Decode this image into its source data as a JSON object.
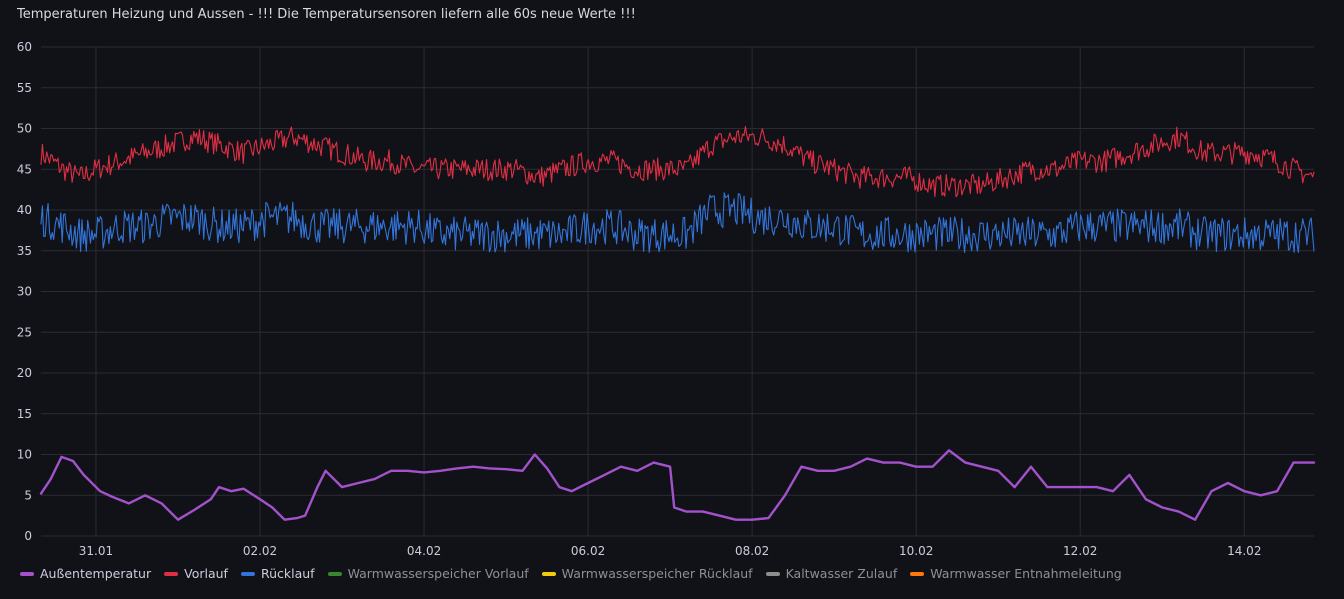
{
  "panel": {
    "title": "Temperaturen Heizung und Aussen - !!! Die Temperatursensoren liefern alle 60s neue Werte !!!"
  },
  "chart_data": {
    "type": "line",
    "title": "Temperaturen Heizung und Aussen - !!! Die Temperatursensoren liefern alle 60s neue Werte !!!",
    "xlabel": "",
    "ylabel": "",
    "ylim": [
      0,
      60
    ],
    "y_ticks": [
      0,
      5,
      10,
      15,
      20,
      25,
      30,
      35,
      40,
      45,
      50,
      55,
      60
    ],
    "x_ticks": [
      "31.01",
      "02.02",
      "04.02",
      "06.02",
      "08.02",
      "10.02",
      "12.02",
      "14.02"
    ],
    "x_range_days": [
      -0.67,
      14.85
    ],
    "grid": true,
    "legend_position": "bottom-left",
    "series": [
      {
        "name": "Außentemperatur",
        "color": "#a352cc",
        "visible": true,
        "x": [
          -0.67,
          -0.55,
          -0.42,
          -0.28,
          -0.15,
          0.05,
          0.2,
          0.4,
          0.6,
          0.8,
          1.0,
          1.2,
          1.4,
          1.5,
          1.65,
          1.8,
          2.0,
          2.15,
          2.3,
          2.45,
          2.55,
          2.7,
          2.8,
          3.0,
          3.2,
          3.4,
          3.6,
          3.8,
          4.0,
          4.2,
          4.4,
          4.6,
          4.8,
          5.0,
          5.2,
          5.35,
          5.5,
          5.65,
          5.8,
          6.0,
          6.2,
          6.4,
          6.6,
          6.8,
          7.0,
          7.05,
          7.2,
          7.4,
          7.6,
          7.8,
          8.0,
          8.2,
          8.4,
          8.6,
          8.8,
          9.0,
          9.2,
          9.4,
          9.6,
          9.8,
          10.0,
          10.2,
          10.4,
          10.6,
          10.8,
          11.0,
          11.2,
          11.4,
          11.6,
          11.8,
          12.0,
          12.2,
          12.4,
          12.6,
          12.8,
          13.0,
          13.2,
          13.4,
          13.6,
          13.8,
          14.0,
          14.2,
          14.4,
          14.6,
          14.85
        ],
        "y": [
          5.2,
          7.0,
          9.7,
          9.2,
          7.5,
          5.5,
          4.8,
          4.0,
          5.0,
          4.0,
          2.0,
          3.2,
          4.5,
          6.0,
          5.5,
          5.8,
          4.5,
          3.5,
          2.0,
          2.2,
          2.5,
          6.0,
          8.0,
          6.0,
          6.5,
          7.0,
          8.0,
          8.0,
          7.8,
          8.0,
          8.3,
          8.5,
          8.3,
          8.2,
          8.0,
          10.0,
          8.3,
          6.0,
          5.5,
          6.5,
          7.5,
          8.5,
          8.0,
          9.0,
          8.5,
          3.5,
          3.0,
          3.0,
          2.5,
          2.0,
          2.0,
          2.2,
          5.0,
          8.5,
          8.0,
          8.0,
          8.5,
          9.5,
          9.0,
          9.0,
          8.5,
          8.5,
          10.5,
          9.0,
          8.5,
          8.0,
          6.0,
          8.5,
          6.0,
          6.0,
          6.0,
          6.0,
          5.5,
          7.5,
          4.5,
          3.5,
          3.0,
          2.0,
          5.5,
          6.5,
          5.5,
          5.0,
          5.5,
          9.0,
          9.0
        ]
      },
      {
        "name": "Vorlauf",
        "color": "#e02f44",
        "visible": true,
        "x": [
          -0.67,
          -0.4,
          -0.2,
          0.0,
          0.3,
          0.6,
          0.9,
          1.2,
          1.5,
          1.8,
          2.1,
          2.4,
          2.7,
          3.0,
          3.3,
          3.6,
          3.9,
          4.2,
          4.5,
          4.8,
          5.1,
          5.4,
          5.7,
          6.0,
          6.3,
          6.6,
          6.9,
          7.2,
          7.5,
          7.8,
          8.1,
          8.4,
          8.7,
          9.0,
          9.3,
          9.6,
          9.9,
          10.2,
          10.5,
          10.8,
          11.1,
          11.4,
          11.7,
          12.0,
          12.3,
          12.6,
          12.9,
          13.2,
          13.5,
          13.8,
          14.1,
          14.4,
          14.6,
          14.85
        ],
        "y": [
          47,
          45,
          44,
          45,
          46,
          47,
          48,
          49,
          48,
          47,
          48,
          49,
          48,
          47,
          46,
          46,
          45,
          45,
          45,
          45,
          45,
          44,
          45,
          46,
          46,
          45,
          45,
          45,
          48,
          49,
          49,
          48,
          46,
          45,
          44,
          44,
          44,
          43,
          43,
          43,
          44,
          45,
          45,
          46,
          46,
          47,
          48,
          49,
          47,
          47,
          47,
          46,
          45,
          44
        ]
      },
      {
        "name": "Rücklauf",
        "color": "#3274d9",
        "visible": true,
        "x": [
          -0.67,
          -0.4,
          -0.2,
          0.0,
          0.3,
          0.6,
          0.9,
          1.2,
          1.5,
          1.8,
          2.1,
          2.4,
          2.7,
          3.0,
          3.3,
          3.6,
          3.9,
          4.2,
          4.5,
          4.8,
          5.1,
          5.4,
          5.7,
          6.0,
          6.3,
          6.6,
          6.9,
          7.2,
          7.5,
          7.8,
          8.1,
          8.4,
          8.7,
          9.0,
          9.3,
          9.6,
          9.9,
          10.2,
          10.5,
          10.8,
          11.1,
          11.4,
          11.7,
          12.0,
          12.3,
          12.6,
          12.9,
          13.2,
          13.5,
          13.8,
          14.1,
          14.4,
          14.6,
          14.85
        ],
        "y": [
          39,
          38,
          37,
          37,
          38,
          38,
          39,
          39,
          38,
          38,
          39,
          39,
          38,
          38,
          38,
          38,
          38,
          37,
          37,
          37,
          37,
          37,
          37,
          38,
          38,
          37,
          37,
          37,
          40,
          40,
          39,
          39,
          38,
          38,
          37,
          37,
          37,
          37,
          37,
          37,
          37,
          37,
          37,
          38,
          38,
          38,
          38,
          38,
          37,
          37,
          37,
          37,
          37,
          37
        ]
      },
      {
        "name": "Warmwasserspeicher Vorlauf",
        "color": "#37872d",
        "visible": false,
        "x": [],
        "y": []
      },
      {
        "name": "Warmwasserspeicher Rücklauf",
        "color": "#f2cc0c",
        "visible": false,
        "x": [],
        "y": []
      },
      {
        "name": "Kaltwasser Zulauf",
        "color": "#8e8e8e",
        "visible": false,
        "x": [],
        "y": []
      },
      {
        "name": "Warmwasser Entnahmeleitung",
        "color": "#ff780a",
        "visible": false,
        "x": [],
        "y": []
      }
    ]
  },
  "legend": {
    "items": [
      {
        "label": "Außentemperatur",
        "color": "#a352cc"
      },
      {
        "label": "Vorlauf",
        "color": "#e02f44"
      },
      {
        "label": "Rücklauf",
        "color": "#3274d9"
      },
      {
        "label": "Warmwasserspeicher Vorlauf",
        "color": "#37872d"
      },
      {
        "label": "Warmwasserspeicher Rücklauf",
        "color": "#f2cc0c"
      },
      {
        "label": "Kaltwasser Zulauf",
        "color": "#8e8e8e"
      },
      {
        "label": "Warmwasser Entnahmeleitung",
        "color": "#ff780a"
      }
    ]
  }
}
